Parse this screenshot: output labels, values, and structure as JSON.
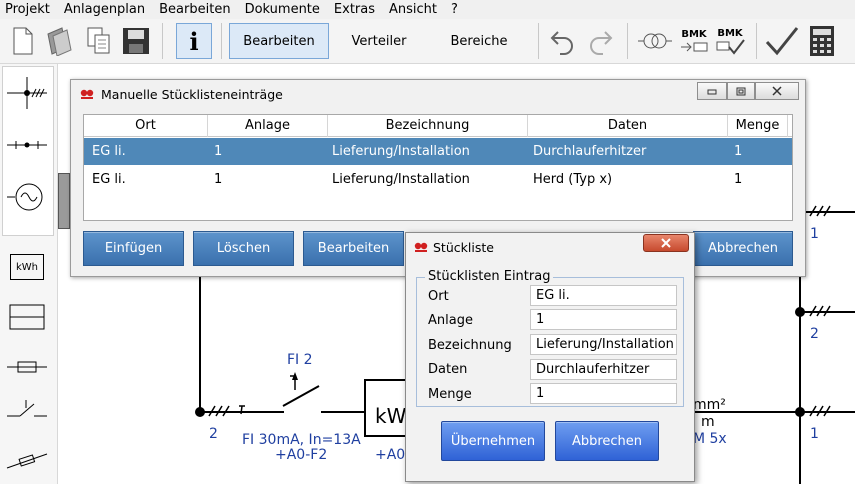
{
  "menu": [
    "Projekt",
    "Anlagenplan",
    "Bearbeiten",
    "Dokumente",
    "Extras",
    "Ansicht",
    "?"
  ],
  "toolbar": {
    "info_label": "i",
    "modes": [
      "Bearbeiten",
      "Verteiler",
      "Bereiche"
    ],
    "bmk1": "BMK",
    "bmk2": "BMK"
  },
  "palette": {
    "kwh_label": "kWh"
  },
  "canvas": {
    "fi_label": "FI 2",
    "fi_desc": "FI 30mA, In=13A",
    "fi_ref": "+A0-F2",
    "kw_label": "kW",
    "ref2_partial": "+A0-",
    "mm_label": "mm²",
    "m_label": "m",
    "m5x_label": "M 5x",
    "num_2_left": "2",
    "num_1_top": "1",
    "num_2_right": "2",
    "num_1_bottom": "1"
  },
  "window_main": {
    "title": "Manuelle Stücklisteneinträge",
    "columns": [
      "Ort",
      "Anlage",
      "Bezeichnung",
      "Daten",
      "Menge"
    ],
    "rows": [
      {
        "ort": "EG li.",
        "anlage": "1",
        "bezeichnung": "Lieferung/Installation",
        "daten": "Durchlauferhitzer",
        "menge": "1"
      },
      {
        "ort": "EG li.",
        "anlage": "1",
        "bezeichnung": "Lieferung/Installation",
        "daten": "Herd (Typ x)",
        "menge": "1"
      }
    ],
    "buttons": {
      "insert": "Einfügen",
      "delete": "Löschen",
      "edit": "Bearbeiten",
      "cancel": "Abbrechen"
    }
  },
  "dialog": {
    "title": "Stückliste",
    "group_title": "Stücklisten Eintrag",
    "fields": [
      {
        "label": "Ort",
        "value": "EG li."
      },
      {
        "label": "Anlage",
        "value": "1"
      },
      {
        "label": "Bezeichnung",
        "value": "Lieferung/Installation"
      },
      {
        "label": "Daten",
        "value": "Durchlauferhitzer"
      },
      {
        "label": "Menge",
        "value": "1"
      }
    ],
    "ok_label": "Übernehmen",
    "cancel_label": "Abbrechen"
  },
  "colors": {
    "selection": "#4f88b8",
    "button_blue": "#3a70ad",
    "canvas_text": "#1f3fa0"
  }
}
